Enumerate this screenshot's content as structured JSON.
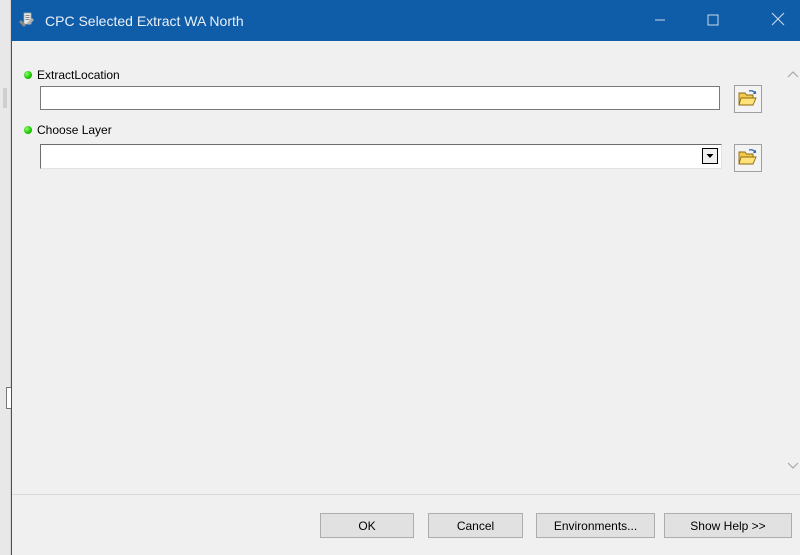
{
  "window": {
    "title": "CPC Selected Extract WA North",
    "accent_color": "#0f5ca9",
    "controls": {
      "minimize_icon": "minimize-icon",
      "maximize_icon": "maximize-icon",
      "close_icon": "close-icon"
    }
  },
  "params": [
    {
      "label": "ExtractLocation",
      "value": "",
      "status_color": "#19c400"
    },
    {
      "label": "Choose Layer",
      "value": "",
      "status_color": "#19c400"
    }
  ],
  "footer": {
    "ok_label": "OK",
    "cancel_label": "Cancel",
    "environments_label": "Environments...",
    "show_help_label": "Show Help >>"
  }
}
